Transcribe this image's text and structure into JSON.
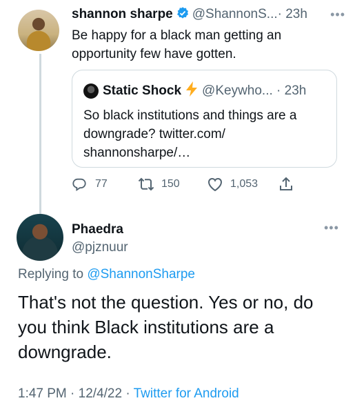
{
  "original_tweet": {
    "author_name": "shannon sharpe",
    "author_handle": "@ShannonS...",
    "separator": "·",
    "time": "23h",
    "text": "Be happy for a black man getting an opportunity few have gotten.",
    "verified_icon": "verified-badge-icon"
  },
  "quoted_tweet": {
    "author_name": "Static Shock",
    "author_handle": "@Keywho...",
    "separator": "·",
    "time": "23h",
    "text": "So black institutions and things are a downgrade? twitter.com/ shannonsharpe/…"
  },
  "actions": {
    "replies": "77",
    "retweets": "150",
    "likes": "1,053"
  },
  "reply": {
    "author_name": "Phaedra",
    "author_handle": "@pjznuur",
    "replying_prefix": "Replying to ",
    "replying_to": "@ShannonSharpe",
    "text": "That's not the question. Yes or no, do you think Black institutions are a downgrade.",
    "time": "1:47 PM",
    "sep1": "·",
    "date": "12/4/22",
    "sep2": "·",
    "client": "Twitter for Android"
  },
  "colors": {
    "accent": "#1d9bf0",
    "muted_text": "#536471",
    "border": "#cfd9de",
    "lightning": "#ffad1f"
  }
}
